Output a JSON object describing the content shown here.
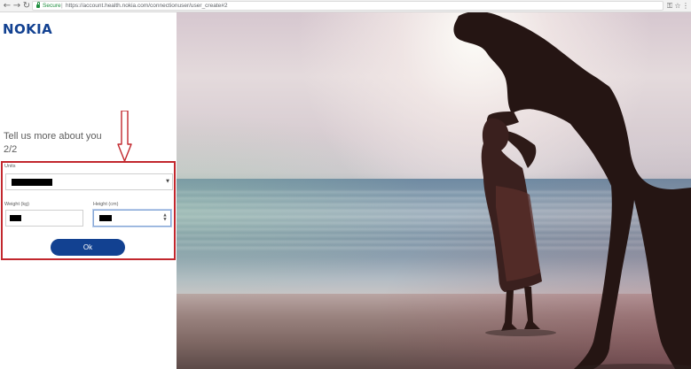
{
  "browser": {
    "back_glyph": "←",
    "forward_glyph": "→",
    "reload_glyph": "↻",
    "security_label": "Secure",
    "separator": "|",
    "url": "https://account.health.nokia.com/connectionuser/user_create#2",
    "key_glyph": "⚿",
    "star_glyph": "☆",
    "menu_glyph": "⋮",
    "secure_color": "#1e8e3e"
  },
  "brand": {
    "logo_text": "NOKIA",
    "color": "#124191"
  },
  "form": {
    "heading": "Tell us more about you",
    "step": "2/2",
    "units_label": "Units",
    "weight_label": "Weight (kg)",
    "height_label": "Height (cm)",
    "submit_label": "Ok",
    "highlight_color": "#c2272d"
  },
  "icons": {
    "select_caret": "▼",
    "spin_up": "▲",
    "spin_down": "▼"
  }
}
